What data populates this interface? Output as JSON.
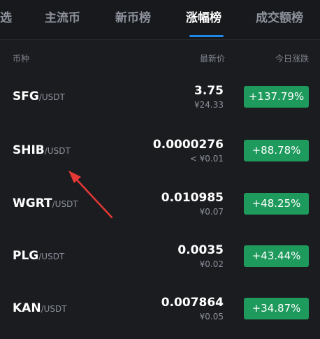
{
  "tabs": [
    {
      "label": "选"
    },
    {
      "label": "主流币"
    },
    {
      "label": "新币榜"
    },
    {
      "label": "涨幅榜"
    },
    {
      "label": "成交额榜"
    }
  ],
  "active_tab": "涨幅榜",
  "columns": {
    "name": "币种",
    "price": "最新价",
    "change": "今日涨跌"
  },
  "rows": [
    {
      "base": "SFG",
      "quote": "/USDT",
      "price": "3.75",
      "cny": "¥24.33",
      "change": "+137.79%"
    },
    {
      "base": "SHIB",
      "quote": "/USDT",
      "price": "0.0000276",
      "cny": "< ¥0.01",
      "change": "+88.78%"
    },
    {
      "base": "WGRT",
      "quote": "/USDT",
      "price": "0.010985",
      "cny": "¥0.07",
      "change": "+48.25%"
    },
    {
      "base": "PLG",
      "quote": "/USDT",
      "price": "0.0035",
      "cny": "¥0.02",
      "change": "+43.44%"
    },
    {
      "base": "KAN",
      "quote": "/USDT",
      "price": "0.007864",
      "cny": "¥0.05",
      "change": "+34.87%"
    }
  ],
  "colors": {
    "up": "#1f9a5d",
    "tab_indicator": "#1e88e5",
    "annotation": "#e53935"
  },
  "annotation": {
    "icon": "red-arrow-icon"
  }
}
